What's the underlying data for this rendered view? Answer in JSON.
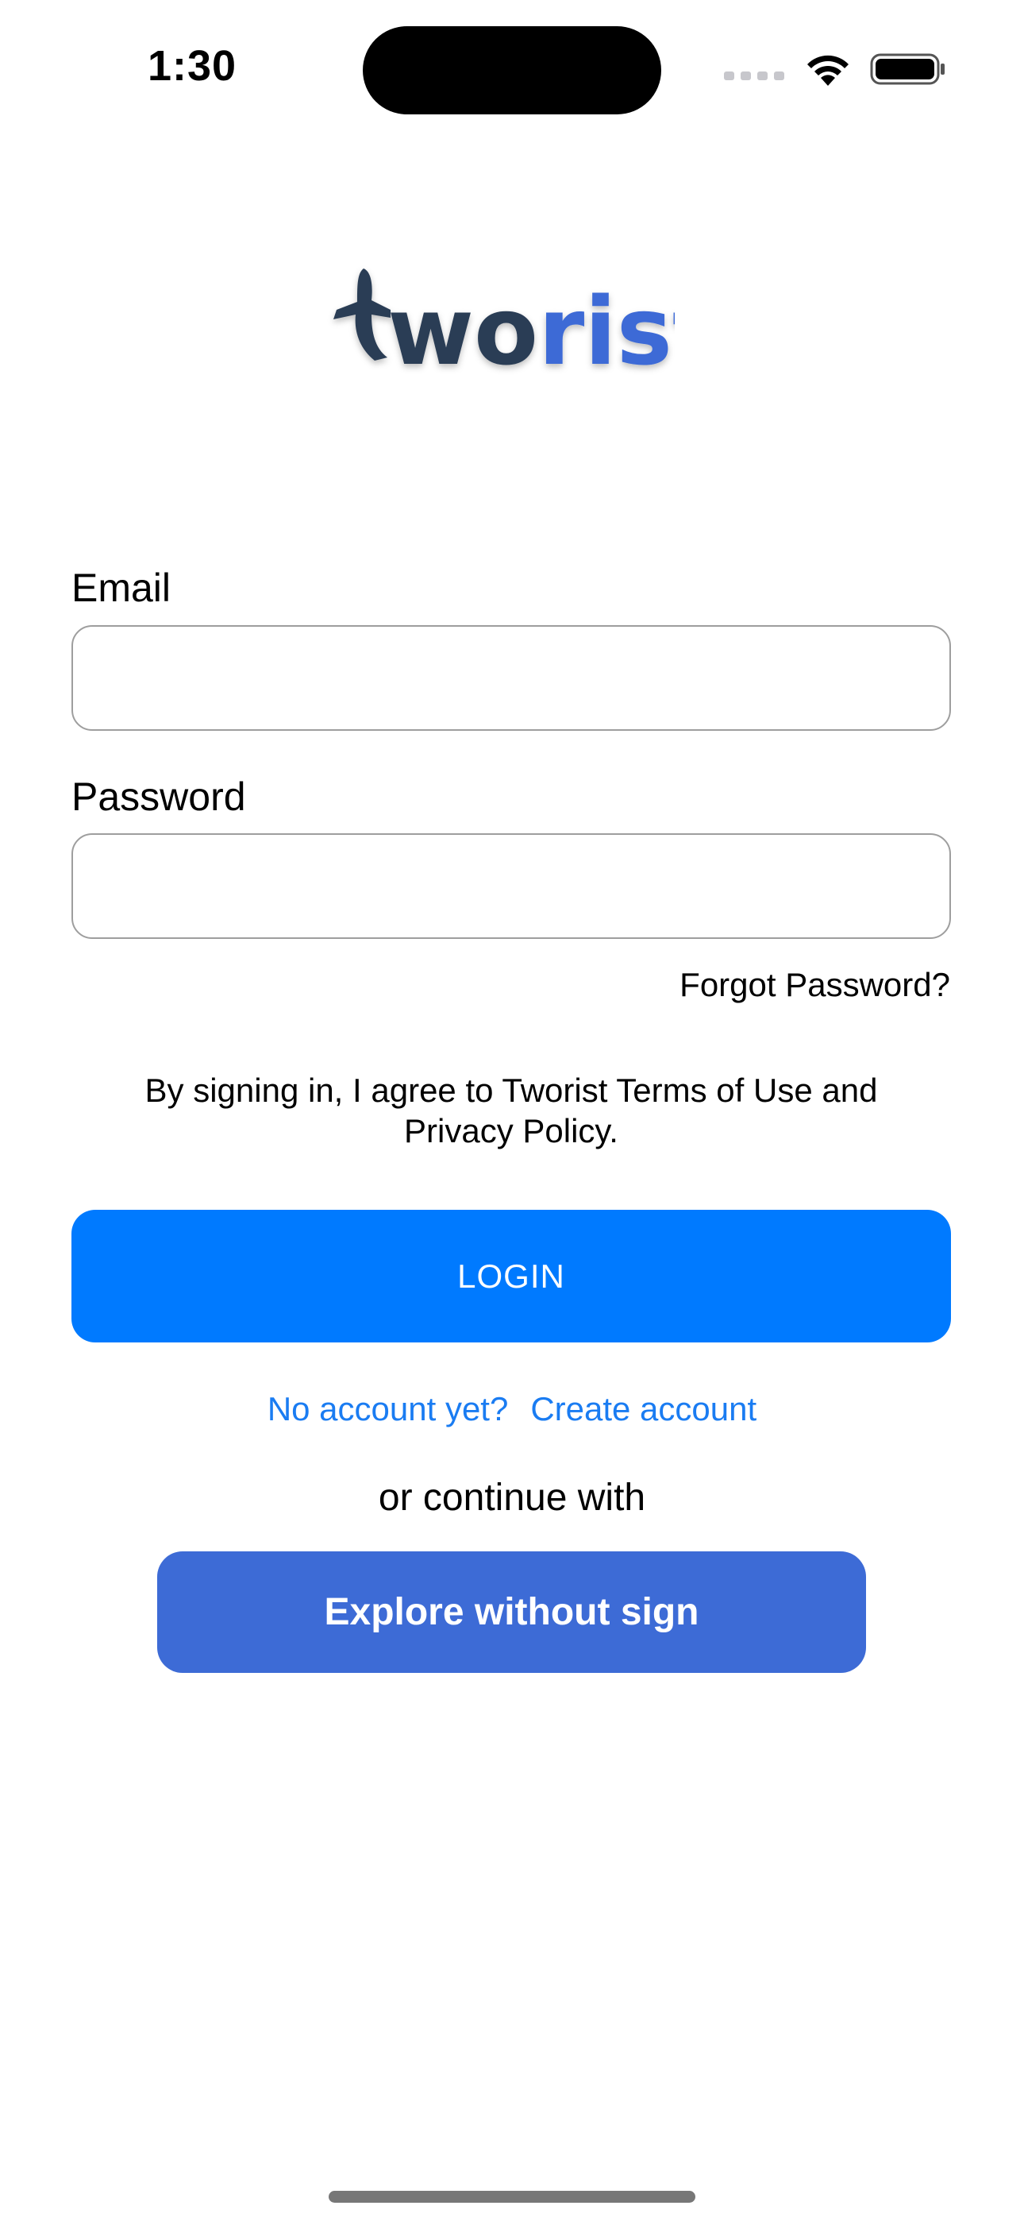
{
  "status_bar": {
    "time": "1:30"
  },
  "logo": {
    "text_dark": "two",
    "text_blue": "rist",
    "colors": {
      "dark": "#2c3e55",
      "blue": "#3d6bd6"
    }
  },
  "form": {
    "email_label": "Email",
    "email_value": "",
    "password_label": "Password",
    "password_value": "",
    "forgot_password": "Forgot Password?"
  },
  "terms": {
    "line1": "By signing in, I agree to Tworist Terms of Use and",
    "line2": "Privacy Policy."
  },
  "login_button": "LOGIN",
  "account": {
    "prompt": "No account yet?",
    "create": "Create account"
  },
  "continue_text": "or continue with",
  "explore_button": "Explore without sign",
  "colors": {
    "primary": "#007aff",
    "explore": "#3d6bd6",
    "link": "#1a7cf2",
    "input_border": "#9e9e9e"
  },
  "icons": {
    "signal": "cellular-signal-icon",
    "wifi": "wifi-icon",
    "battery": "battery-icon"
  }
}
